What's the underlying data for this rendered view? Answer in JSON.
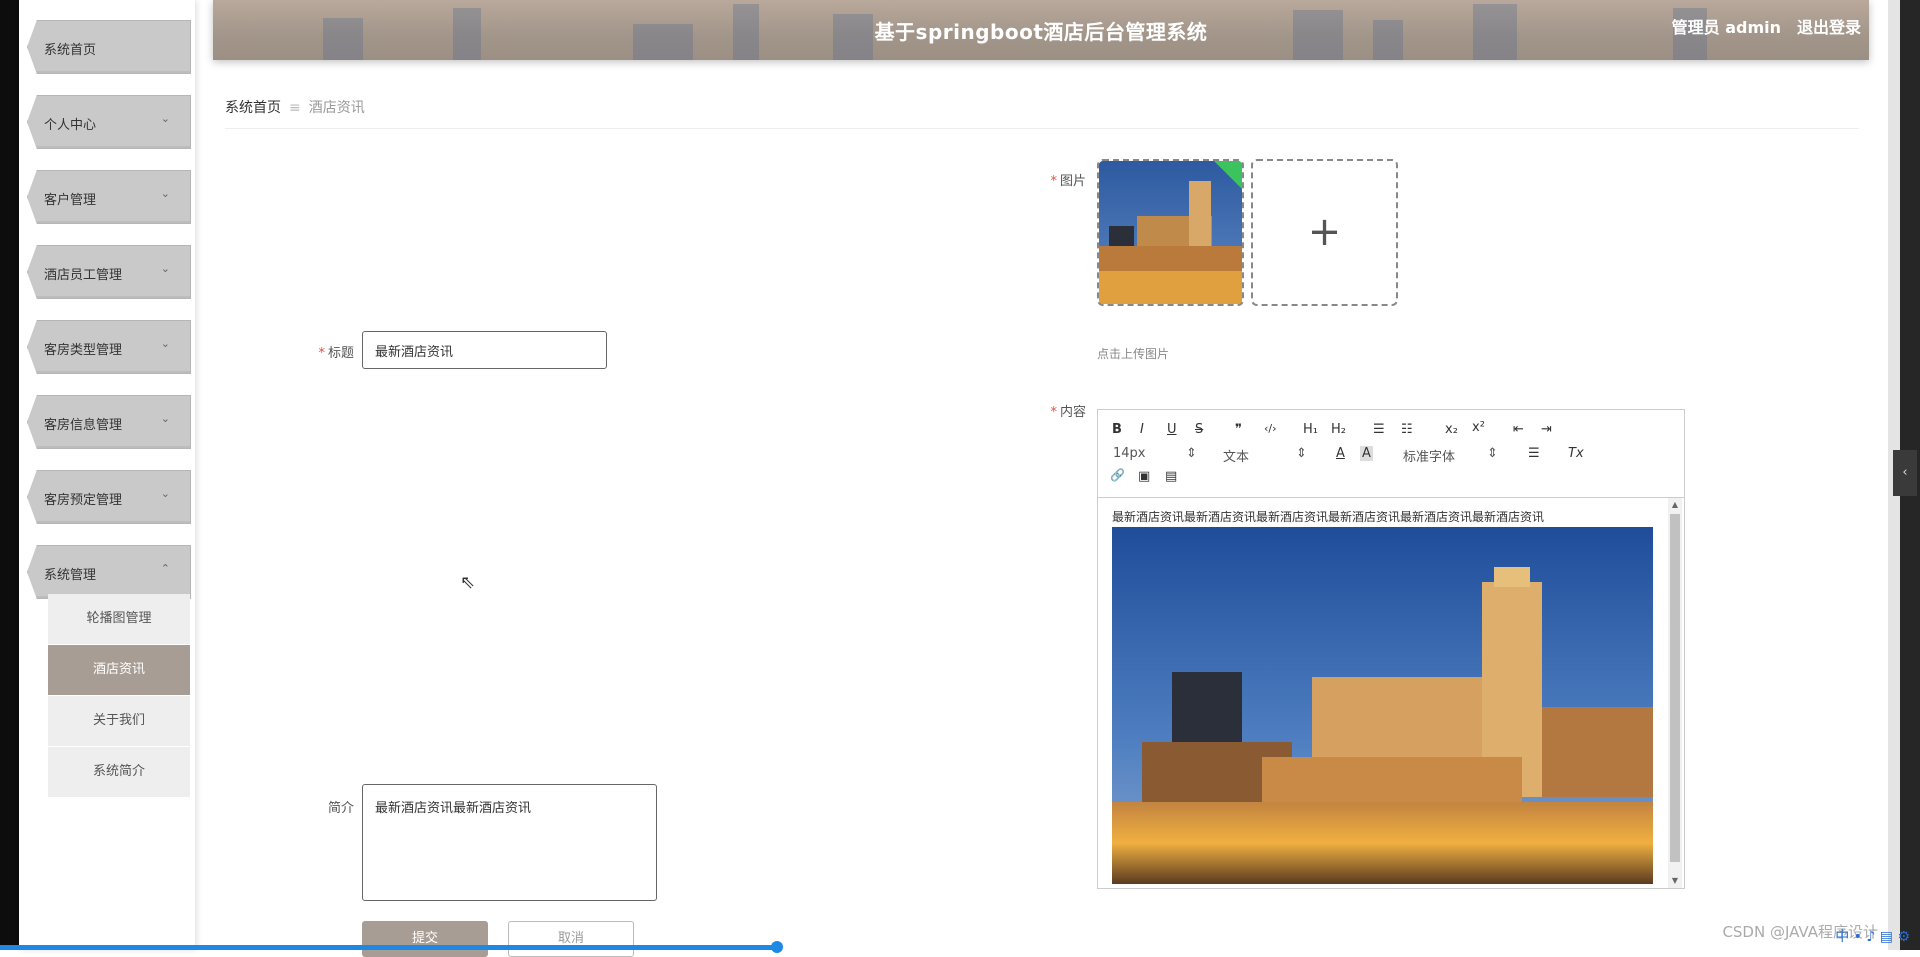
{
  "header": {
    "title": "基于springboot酒店后台管理系统",
    "user_label": "管理员 admin",
    "logout_label": "退出登录"
  },
  "sidebar": {
    "items": [
      {
        "label": "系统首页",
        "expanded": null
      },
      {
        "label": "个人中心",
        "expanded": false
      },
      {
        "label": "客户管理",
        "expanded": false
      },
      {
        "label": "酒店员工管理",
        "expanded": false
      },
      {
        "label": "客房类型管理",
        "expanded": false
      },
      {
        "label": "客房信息管理",
        "expanded": false
      },
      {
        "label": "客房预定管理",
        "expanded": false
      },
      {
        "label": "系统管理",
        "expanded": true
      }
    ],
    "submenu": [
      {
        "label": "轮播图管理",
        "active": false
      },
      {
        "label": "酒店资讯",
        "active": true
      },
      {
        "label": "关于我们",
        "active": false
      },
      {
        "label": "系统简介",
        "active": false
      }
    ]
  },
  "breadcrumb": {
    "home": "系统首页",
    "separator": "≡",
    "current": "酒店资讯"
  },
  "form": {
    "title_label": "标题",
    "title_value": "最新酒店资讯",
    "image_label": "图片",
    "upload_tip": "点击上传图片",
    "upload_plus": "+",
    "content_label": "内容",
    "intro_label": "简介",
    "intro_value": "最新酒店资讯最新酒店资讯",
    "submit_label": "提交",
    "cancel_label": "取消"
  },
  "editor": {
    "toolbar": {
      "bold": "B",
      "italic": "I",
      "underline": "U",
      "strike": "S",
      "quote": "❞",
      "code": "‹/›",
      "h1": "H₁",
      "h2": "H₂",
      "ordered": "☰",
      "bullet": "☷",
      "sub": "x₂",
      "sup": "x²",
      "indent_out": "⇤",
      "indent_in": "⇥",
      "size": "14px",
      "size_arrow": "⇕",
      "header": "文本",
      "header_arrow": "⇕",
      "color": "A",
      "bg": "A",
      "font": "标准字体",
      "font_arrow": "⇕",
      "align": "☰",
      "clean": "Tx",
      "link": "🔗",
      "image": "▣",
      "video": "▤"
    },
    "text": "最新酒店资讯最新酒店资讯最新酒店资讯最新酒店资讯最新酒店资讯最新酒店资讯"
  },
  "side_tab": "‹",
  "watermark": "CSDN @JAVA程序设计",
  "tray": "中 • ♪ ▤ ⚙"
}
